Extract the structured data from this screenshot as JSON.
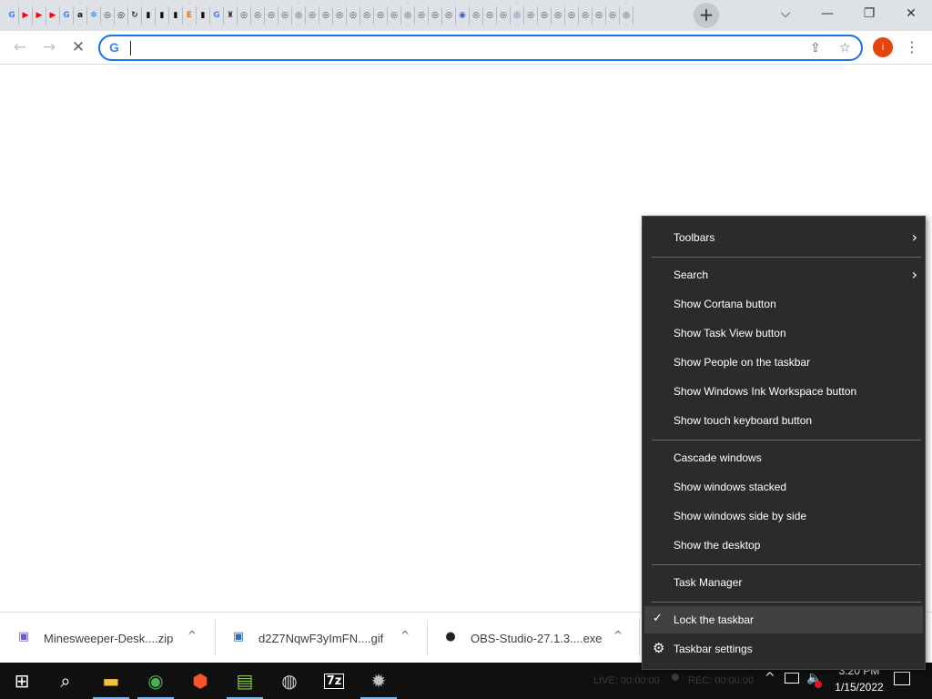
{
  "browser": {
    "tab_icons": [
      {
        "glyph": "G",
        "color": "#4285f4",
        "icon": "google-icon"
      },
      {
        "glyph": "▶",
        "color": "#ff0000",
        "icon": "youtube-icon"
      },
      {
        "glyph": "▶",
        "color": "#ff0000",
        "icon": "youtube-icon"
      },
      {
        "glyph": "▶",
        "color": "#ff0000",
        "icon": "youtube-icon"
      },
      {
        "glyph": "G",
        "color": "#4285f4",
        "icon": "google-icon"
      },
      {
        "glyph": "a",
        "color": "#111111",
        "icon": "amazon-icon"
      },
      {
        "glyph": "✻",
        "color": "#3b8fe0",
        "icon": "snowflake-icon"
      },
      {
        "glyph": "◎",
        "color": "#333333",
        "icon": "site-icon"
      },
      {
        "glyph": "◎",
        "color": "#111111",
        "icon": "site-icon"
      },
      {
        "glyph": "↻",
        "color": "#333333",
        "icon": "reload-site-icon"
      },
      {
        "glyph": "▮",
        "color": "#111111",
        "icon": "document-icon"
      },
      {
        "glyph": "▮",
        "color": "#111111",
        "icon": "document-icon"
      },
      {
        "glyph": "▮",
        "color": "#111111",
        "icon": "document-icon"
      },
      {
        "glyph": "E",
        "color": "#e8710a",
        "icon": "e-site-icon"
      },
      {
        "glyph": "▮",
        "color": "#111111",
        "icon": "document-icon"
      },
      {
        "glyph": "G",
        "color": "#4285f4",
        "icon": "google-icon"
      },
      {
        "glyph": "♜",
        "color": "#333333",
        "icon": "site-icon"
      },
      {
        "glyph": "◎",
        "color": "#444444",
        "icon": "site-icon"
      },
      {
        "glyph": "◎",
        "color": "#444444",
        "icon": "site-icon"
      },
      {
        "glyph": "◎",
        "color": "#444444",
        "icon": "site-icon"
      },
      {
        "glyph": "◎",
        "color": "#444444",
        "icon": "site-icon"
      },
      {
        "glyph": "◎",
        "color": "#444444",
        "icon": "site-icon"
      },
      {
        "glyph": "◎",
        "color": "#444444",
        "icon": "site-icon"
      },
      {
        "glyph": "◎",
        "color": "#444444",
        "icon": "site-icon"
      },
      {
        "glyph": "◎",
        "color": "#444444",
        "icon": "site-icon"
      },
      {
        "glyph": "◎",
        "color": "#444444",
        "icon": "site-icon"
      },
      {
        "glyph": "◎",
        "color": "#444444",
        "icon": "site-icon"
      },
      {
        "glyph": "◎",
        "color": "#444444",
        "icon": "site-icon"
      },
      {
        "glyph": "◎",
        "color": "#444444",
        "icon": "site-icon"
      },
      {
        "glyph": "◎",
        "color": "#444444",
        "icon": "site-icon"
      },
      {
        "glyph": "◎",
        "color": "#444444",
        "icon": "site-icon"
      },
      {
        "glyph": "◎",
        "color": "#444444",
        "icon": "site-icon"
      },
      {
        "glyph": "◎",
        "color": "#444444",
        "icon": "site-icon"
      },
      {
        "glyph": "◉",
        "color": "#3b5fc9",
        "icon": "site-icon"
      },
      {
        "glyph": "◎",
        "color": "#444444",
        "icon": "site-icon"
      },
      {
        "glyph": "◎",
        "color": "#444444",
        "icon": "site-icon"
      },
      {
        "glyph": "◎",
        "color": "#444444",
        "icon": "site-icon"
      },
      {
        "glyph": "◎",
        "color": "#3b5fc9",
        "icon": "site-icon"
      },
      {
        "glyph": "◎",
        "color": "#444444",
        "icon": "site-icon"
      },
      {
        "glyph": "◎",
        "color": "#444444",
        "icon": "site-icon"
      },
      {
        "glyph": "◎",
        "color": "#444444",
        "icon": "site-icon"
      },
      {
        "glyph": "◎",
        "color": "#444444",
        "icon": "site-icon"
      },
      {
        "glyph": "◎",
        "color": "#444444",
        "icon": "site-icon"
      },
      {
        "glyph": "◎",
        "color": "#444444",
        "icon": "site-icon"
      },
      {
        "glyph": "◎",
        "color": "#444444",
        "icon": "site-icon"
      },
      {
        "glyph": "◎",
        "color": "#444444",
        "icon": "site-icon"
      }
    ],
    "new_tab_glyph": "+",
    "window_controls": {
      "dropdown": "⌵",
      "minimize": "—",
      "restore": "❐",
      "close": "✕"
    },
    "nav": {
      "back": "←",
      "forward": "→",
      "stop": "✕"
    },
    "omnibox": {
      "value": "",
      "placeholder": "",
      "google_glyph": "G",
      "share_glyph": "⇪",
      "bookmark_glyph": "☆"
    },
    "profile_initial": "i",
    "menu_glyph": "⋮"
  },
  "downloads": [
    {
      "name": "Minesweeper-Desk....zip",
      "icon_glyph": "▣",
      "icon_color": "#6b5bd6",
      "chevron": "^"
    },
    {
      "name": "d2Z7NqwF3yImFN....gif",
      "icon_glyph": "▣",
      "icon_color": "#2d6db5",
      "chevron": "^"
    },
    {
      "name": "OBS-Studio-27.1.3....exe",
      "icon_glyph": "●",
      "icon_color": "#222222",
      "chevron": "^"
    }
  ],
  "context_menu": {
    "toolbars": "Toolbars",
    "search": "Search",
    "show_cortana": "Show Cortana button",
    "show_task_view": "Show Task View button",
    "show_people": "Show People on the taskbar",
    "show_ink": "Show Windows Ink Workspace button",
    "show_touch_keyboard": "Show touch keyboard button",
    "cascade": "Cascade windows",
    "stacked": "Show windows stacked",
    "side_by_side": "Show windows side by side",
    "show_desktop": "Show the desktop",
    "task_manager": "Task Manager",
    "lock_taskbar": "Lock the taskbar",
    "lock_taskbar_checked": true,
    "taskbar_settings": "Taskbar settings",
    "submenu_arrow": "›",
    "check_glyph": "✓",
    "gear_glyph": "⚙"
  },
  "taskbar": {
    "start_glyph": "⊞",
    "search_glyph": "⌕",
    "apps": [
      {
        "name": "file-explorer",
        "glyph": "▬",
        "color": "#f0c33c",
        "active": true
      },
      {
        "name": "chrome",
        "glyph": "◉",
        "color": "#4caf50",
        "active": true
      },
      {
        "name": "brave",
        "glyph": "⬢",
        "color": "#fb542b",
        "active": false
      },
      {
        "name": "notepad-plus-plus",
        "glyph": "▤",
        "color": "#8bc34a",
        "active": true
      },
      {
        "name": "obs-studio",
        "glyph": "◍",
        "color": "#cccccc",
        "active": false
      },
      {
        "name": "7-zip",
        "glyph": "7z",
        "color": "#ffffff",
        "active": false
      },
      {
        "name": "settings-gear",
        "glyph": "✹",
        "color": "#c0c0c0",
        "active": true
      }
    ],
    "live_status": "LIVE: 00:00:00",
    "rec_status": "REC: 00:00:00",
    "tray_chevron": "^",
    "clock_time": "3:20 PM",
    "clock_date": "1/15/2022",
    "notification_glyph": "▭"
  },
  "colors": {
    "accent": "#1a73e8",
    "menu_bg": "#2b2b2b",
    "menu_highlight": "#414141",
    "taskbar_bg": "#101010"
  }
}
